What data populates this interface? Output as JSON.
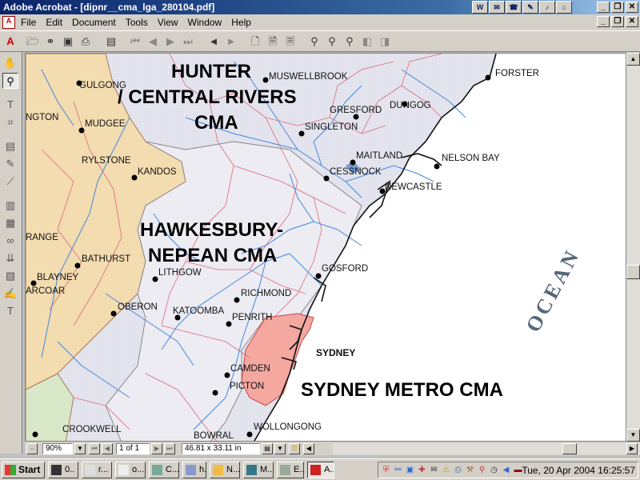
{
  "window": {
    "title": "Adobe Acrobat - [dipnr__cma_lga_280104.pdf]"
  },
  "menu": {
    "items": [
      "File",
      "Edit",
      "Document",
      "Tools",
      "View",
      "Window",
      "Help"
    ]
  },
  "map": {
    "cma_labels": {
      "hunter": "HUNTER",
      "central_rivers": "/ CENTRAL RIVERS",
      "hunter_cma": "CMA",
      "hawkesbury": "HAWKESBURY-",
      "nepean": "NEPEAN  CMA",
      "sydney_metro": "SYDNEY METRO CMA"
    },
    "ocean": "OCEAN",
    "towns": {
      "gulgong": "GULGONG",
      "mudgee": "MUDGEE",
      "ngton": "NGTON",
      "rylstone": "RYLSTONE",
      "kandos": "KANDOS",
      "range": "RANGE",
      "bathurst": "BATHURST",
      "blayney": "BLAYNEY",
      "arcoar": "ARCOAR",
      "lithgow": "LITHGOW",
      "oberon": "OBERON",
      "katoomba": "KATOOMBA",
      "richmond": "RICHMOND",
      "penrith": "PENRITH",
      "camden": "CAMDEN",
      "picton": "PICTON",
      "bowral": "BOWRAL",
      "crookwell": "CROOKWELL",
      "wollongong": "WOLLONGONG",
      "sydney": "SYDNEY",
      "gosford": "GOSFORD",
      "newcastle": "NEWCASTLE",
      "cessnock": "CESSNOCK",
      "maitland": "MAITLAND",
      "singleton": "SINGLETON",
      "gresford": "GRESFORD",
      "dungog": "DUNGOG",
      "muswellbrook": "MUSWELLBROOK",
      "forster": "FORSTER",
      "nelson_bay": "NELSON BAY"
    }
  },
  "statusbar": {
    "zoom": "90%",
    "page": "1 of 1",
    "page_size": "46.81 x 33.11 in"
  },
  "taskbar": {
    "start": "Start",
    "tasks": [
      "0..",
      "r...",
      "o...",
      "C...",
      "h...",
      "N...",
      "M...",
      "E...",
      "A..."
    ],
    "clock": "Tue, 20 Apr 2004   16:25:57"
  },
  "colors": {
    "titlebar": "#0a246a",
    "hunter_region": "#e4e4ee",
    "west_region": "#f2dcb0",
    "sydney_region": "#f4a8a0",
    "rivers": "#4488dd",
    "lga_boundaries": "#dd6677"
  }
}
